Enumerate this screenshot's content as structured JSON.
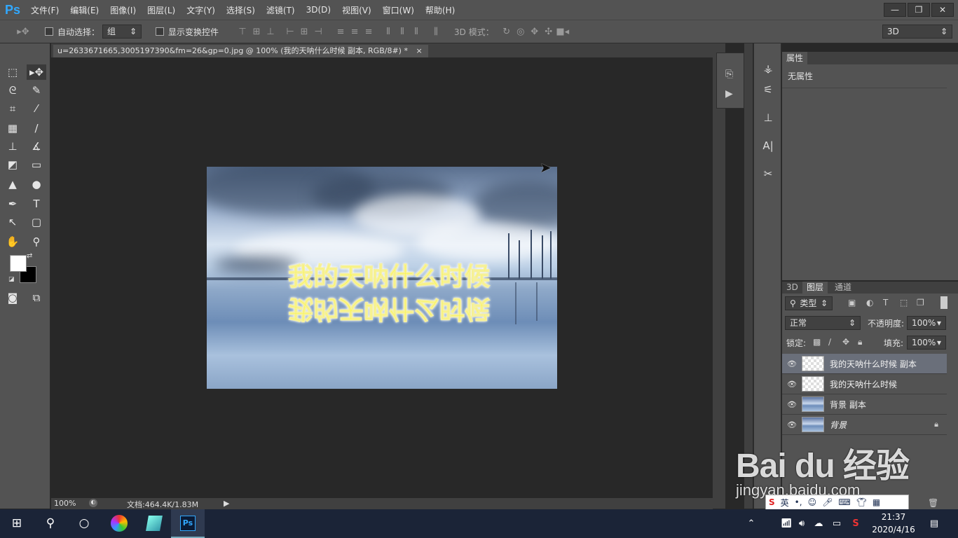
{
  "app": {
    "logo": "Ps"
  },
  "menu": [
    "文件(F)",
    "编辑(E)",
    "图像(I)",
    "图层(L)",
    "文字(Y)",
    "选择(S)",
    "滤镜(T)",
    "3D(D)",
    "视图(V)",
    "窗口(W)",
    "帮助(H)"
  ],
  "window_buttons": {
    "minimize": "—",
    "restore": "❐",
    "close": "✕"
  },
  "options": {
    "auto_select_label": "自动选择：",
    "auto_select_value": "组",
    "show_transform_label": "显示变换控件",
    "mode_3d_label": "3D 模式：",
    "workspace_value": "3D"
  },
  "document": {
    "tab_title": "u=2633671665,3005197390&fm=26&gp=0.jpg @ 100% (我的天呐什么时候 副本, RGB/8#) *",
    "tab_close": "×",
    "canvas_text": "我的天呐什么时候",
    "zoom": "100%",
    "doc_info": "文档:464.4K/1.83M"
  },
  "properties": {
    "tab": "属性",
    "body": "无属性"
  },
  "layers_panel": {
    "tabs": [
      "3D",
      "图层",
      "通道"
    ],
    "filter_label": "类型",
    "blend_mode": "正常",
    "opacity_label": "不透明度:",
    "opacity_value": "100%",
    "lock_label": "锁定:",
    "fill_label": "填充:",
    "fill_value": "100%",
    "layers": [
      {
        "name": "我的天呐什么时候 副本",
        "thumb": "checker",
        "active": true,
        "locked": false
      },
      {
        "name": "我的天呐什么时候",
        "thumb": "checker",
        "active": false,
        "locked": false
      },
      {
        "name": "背景 副本",
        "thumb": "photo",
        "active": false,
        "locked": false
      },
      {
        "name": "背景",
        "thumb": "photo",
        "active": false,
        "locked": true
      }
    ]
  },
  "taskbar": {
    "time": "21:37",
    "date": "2020/4/16",
    "ime_lang": "英"
  },
  "watermark": {
    "logo": "Bai du 经验",
    "url": "jingyan.baidu.com"
  },
  "colors": {
    "ps_blue": "#31a8ff",
    "text_yellow": "#fffb3a",
    "panel": "#535353"
  }
}
